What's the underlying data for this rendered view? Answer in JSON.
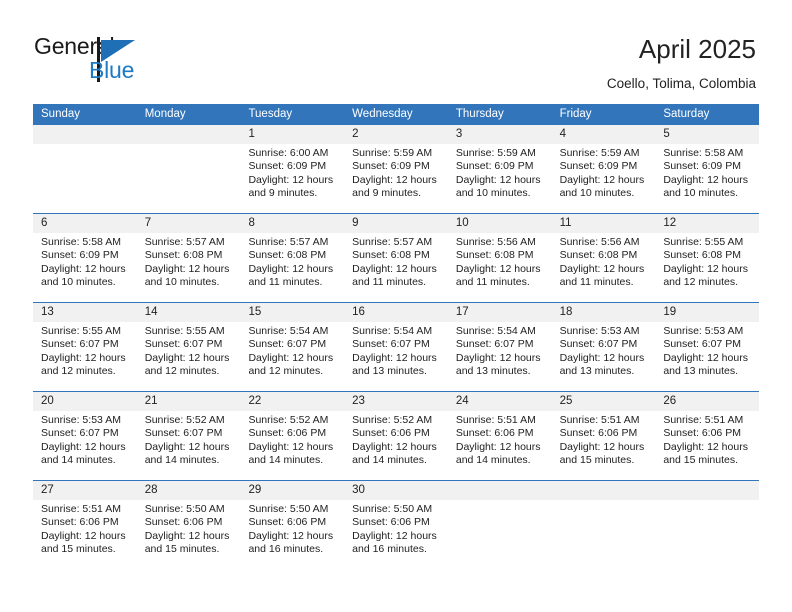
{
  "brand": {
    "name_top": "General",
    "name_bottom": "Blue",
    "accent_color": "#1f7ac4",
    "header_color": "#3275bb"
  },
  "header": {
    "title": "April 2025",
    "location": "Coello, Tolima, Colombia"
  },
  "weekdays": [
    "Sunday",
    "Monday",
    "Tuesday",
    "Wednesday",
    "Thursday",
    "Friday",
    "Saturday"
  ],
  "weeks": [
    [
      {
        "day": "",
        "sunrise": "",
        "sunset": "",
        "daylight_1": "",
        "daylight_2": ""
      },
      {
        "day": "",
        "sunrise": "",
        "sunset": "",
        "daylight_1": "",
        "daylight_2": ""
      },
      {
        "day": "1",
        "sunrise": "Sunrise: 6:00 AM",
        "sunset": "Sunset: 6:09 PM",
        "daylight_1": "Daylight: 12 hours",
        "daylight_2": "and 9 minutes."
      },
      {
        "day": "2",
        "sunrise": "Sunrise: 5:59 AM",
        "sunset": "Sunset: 6:09 PM",
        "daylight_1": "Daylight: 12 hours",
        "daylight_2": "and 9 minutes."
      },
      {
        "day": "3",
        "sunrise": "Sunrise: 5:59 AM",
        "sunset": "Sunset: 6:09 PM",
        "daylight_1": "Daylight: 12 hours",
        "daylight_2": "and 10 minutes."
      },
      {
        "day": "4",
        "sunrise": "Sunrise: 5:59 AM",
        "sunset": "Sunset: 6:09 PM",
        "daylight_1": "Daylight: 12 hours",
        "daylight_2": "and 10 minutes."
      },
      {
        "day": "5",
        "sunrise": "Sunrise: 5:58 AM",
        "sunset": "Sunset: 6:09 PM",
        "daylight_1": "Daylight: 12 hours",
        "daylight_2": "and 10 minutes."
      }
    ],
    [
      {
        "day": "6",
        "sunrise": "Sunrise: 5:58 AM",
        "sunset": "Sunset: 6:09 PM",
        "daylight_1": "Daylight: 12 hours",
        "daylight_2": "and 10 minutes."
      },
      {
        "day": "7",
        "sunrise": "Sunrise: 5:57 AM",
        "sunset": "Sunset: 6:08 PM",
        "daylight_1": "Daylight: 12 hours",
        "daylight_2": "and 10 minutes."
      },
      {
        "day": "8",
        "sunrise": "Sunrise: 5:57 AM",
        "sunset": "Sunset: 6:08 PM",
        "daylight_1": "Daylight: 12 hours",
        "daylight_2": "and 11 minutes."
      },
      {
        "day": "9",
        "sunrise": "Sunrise: 5:57 AM",
        "sunset": "Sunset: 6:08 PM",
        "daylight_1": "Daylight: 12 hours",
        "daylight_2": "and 11 minutes."
      },
      {
        "day": "10",
        "sunrise": "Sunrise: 5:56 AM",
        "sunset": "Sunset: 6:08 PM",
        "daylight_1": "Daylight: 12 hours",
        "daylight_2": "and 11 minutes."
      },
      {
        "day": "11",
        "sunrise": "Sunrise: 5:56 AM",
        "sunset": "Sunset: 6:08 PM",
        "daylight_1": "Daylight: 12 hours",
        "daylight_2": "and 11 minutes."
      },
      {
        "day": "12",
        "sunrise": "Sunrise: 5:55 AM",
        "sunset": "Sunset: 6:08 PM",
        "daylight_1": "Daylight: 12 hours",
        "daylight_2": "and 12 minutes."
      }
    ],
    [
      {
        "day": "13",
        "sunrise": "Sunrise: 5:55 AM",
        "sunset": "Sunset: 6:07 PM",
        "daylight_1": "Daylight: 12 hours",
        "daylight_2": "and 12 minutes."
      },
      {
        "day": "14",
        "sunrise": "Sunrise: 5:55 AM",
        "sunset": "Sunset: 6:07 PM",
        "daylight_1": "Daylight: 12 hours",
        "daylight_2": "and 12 minutes."
      },
      {
        "day": "15",
        "sunrise": "Sunrise: 5:54 AM",
        "sunset": "Sunset: 6:07 PM",
        "daylight_1": "Daylight: 12 hours",
        "daylight_2": "and 12 minutes."
      },
      {
        "day": "16",
        "sunrise": "Sunrise: 5:54 AM",
        "sunset": "Sunset: 6:07 PM",
        "daylight_1": "Daylight: 12 hours",
        "daylight_2": "and 13 minutes."
      },
      {
        "day": "17",
        "sunrise": "Sunrise: 5:54 AM",
        "sunset": "Sunset: 6:07 PM",
        "daylight_1": "Daylight: 12 hours",
        "daylight_2": "and 13 minutes."
      },
      {
        "day": "18",
        "sunrise": "Sunrise: 5:53 AM",
        "sunset": "Sunset: 6:07 PM",
        "daylight_1": "Daylight: 12 hours",
        "daylight_2": "and 13 minutes."
      },
      {
        "day": "19",
        "sunrise": "Sunrise: 5:53 AM",
        "sunset": "Sunset: 6:07 PM",
        "daylight_1": "Daylight: 12 hours",
        "daylight_2": "and 13 minutes."
      }
    ],
    [
      {
        "day": "20",
        "sunrise": "Sunrise: 5:53 AM",
        "sunset": "Sunset: 6:07 PM",
        "daylight_1": "Daylight: 12 hours",
        "daylight_2": "and 14 minutes."
      },
      {
        "day": "21",
        "sunrise": "Sunrise: 5:52 AM",
        "sunset": "Sunset: 6:07 PM",
        "daylight_1": "Daylight: 12 hours",
        "daylight_2": "and 14 minutes."
      },
      {
        "day": "22",
        "sunrise": "Sunrise: 5:52 AM",
        "sunset": "Sunset: 6:06 PM",
        "daylight_1": "Daylight: 12 hours",
        "daylight_2": "and 14 minutes."
      },
      {
        "day": "23",
        "sunrise": "Sunrise: 5:52 AM",
        "sunset": "Sunset: 6:06 PM",
        "daylight_1": "Daylight: 12 hours",
        "daylight_2": "and 14 minutes."
      },
      {
        "day": "24",
        "sunrise": "Sunrise: 5:51 AM",
        "sunset": "Sunset: 6:06 PM",
        "daylight_1": "Daylight: 12 hours",
        "daylight_2": "and 14 minutes."
      },
      {
        "day": "25",
        "sunrise": "Sunrise: 5:51 AM",
        "sunset": "Sunset: 6:06 PM",
        "daylight_1": "Daylight: 12 hours",
        "daylight_2": "and 15 minutes."
      },
      {
        "day": "26",
        "sunrise": "Sunrise: 5:51 AM",
        "sunset": "Sunset: 6:06 PM",
        "daylight_1": "Daylight: 12 hours",
        "daylight_2": "and 15 minutes."
      }
    ],
    [
      {
        "day": "27",
        "sunrise": "Sunrise: 5:51 AM",
        "sunset": "Sunset: 6:06 PM",
        "daylight_1": "Daylight: 12 hours",
        "daylight_2": "and 15 minutes."
      },
      {
        "day": "28",
        "sunrise": "Sunrise: 5:50 AM",
        "sunset": "Sunset: 6:06 PM",
        "daylight_1": "Daylight: 12 hours",
        "daylight_2": "and 15 minutes."
      },
      {
        "day": "29",
        "sunrise": "Sunrise: 5:50 AM",
        "sunset": "Sunset: 6:06 PM",
        "daylight_1": "Daylight: 12 hours",
        "daylight_2": "and 16 minutes."
      },
      {
        "day": "30",
        "sunrise": "Sunrise: 5:50 AM",
        "sunset": "Sunset: 6:06 PM",
        "daylight_1": "Daylight: 12 hours",
        "daylight_2": "and 16 minutes."
      },
      {
        "day": "",
        "sunrise": "",
        "sunset": "",
        "daylight_1": "",
        "daylight_2": ""
      },
      {
        "day": "",
        "sunrise": "",
        "sunset": "",
        "daylight_1": "",
        "daylight_2": ""
      },
      {
        "day": "",
        "sunrise": "",
        "sunset": "",
        "daylight_1": "",
        "daylight_2": ""
      }
    ]
  ]
}
